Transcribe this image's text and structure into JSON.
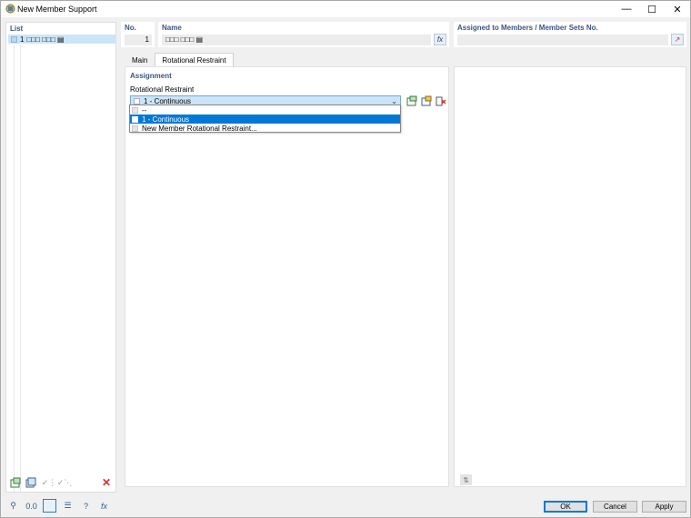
{
  "window": {
    "title": "New Member Support"
  },
  "list": {
    "header": "List",
    "items": [
      {
        "number": "1",
        "label": "□□□ □□□ ▤"
      }
    ]
  },
  "no": {
    "header": "No.",
    "value": "1"
  },
  "name": {
    "header": "Name",
    "value": "□□□ □□□ ▤",
    "fx_label": "fx"
  },
  "assigned": {
    "header": "Assigned to Members / Member Sets No.",
    "value": ""
  },
  "tabs": [
    {
      "label": "Main",
      "active": false
    },
    {
      "label": "Rotational Restraint",
      "active": true
    }
  ],
  "assignment": {
    "header": "Assignment",
    "rotational_restraint_label": "Rotational Restraint",
    "selected_value": "1 - Continuous",
    "options": [
      "--",
      "1 - Continuous",
      "New Member Rotational Restraint..."
    ],
    "selected_index": 1
  },
  "buttons": {
    "ok": "OK",
    "cancel": "Cancel",
    "apply": "Apply"
  },
  "colors": {
    "accent": "#0078d7",
    "selection": "#cce4f7",
    "header": "#3b5680",
    "delete": "#d32f2f"
  }
}
